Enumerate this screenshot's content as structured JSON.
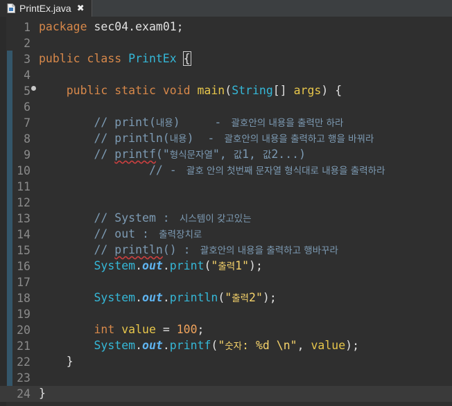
{
  "tab": {
    "title": "PrintEx.java",
    "close": "✖",
    "icon": "java-file-icon"
  },
  "colors": {
    "bg": "#2f2f2f",
    "keyword": "#d7884a",
    "type": "#35b8d8",
    "comment": "#7d9bb4",
    "string": "#f6d36b"
  },
  "lines": [
    {
      "n": "1",
      "tokens": [
        [
          "kw",
          "package"
        ],
        [
          "pl",
          " sec04.exam01;"
        ]
      ]
    },
    {
      "n": "2",
      "tokens": []
    },
    {
      "n": "3",
      "tokens": [
        [
          "kw",
          "public class "
        ],
        [
          "cls",
          "PrintEx"
        ],
        [
          "pl",
          " "
        ],
        [
          "brace",
          "{"
        ]
      ]
    },
    {
      "n": "4",
      "tokens": []
    },
    {
      "n": "5",
      "tokens": [
        [
          "pl",
          "    "
        ],
        [
          "kw",
          "public static void "
        ],
        [
          "fn",
          "main"
        ],
        [
          "pl",
          "("
        ],
        [
          "ty",
          "String"
        ],
        [
          "pl",
          "[] "
        ],
        [
          "fn",
          "args"
        ],
        [
          "pl",
          ") {"
        ]
      ]
    },
    {
      "n": "6",
      "tokens": []
    },
    {
      "n": "7",
      "tokens": [
        [
          "cm",
          "        // print("
        ],
        [
          "cmk",
          "내용"
        ],
        [
          "cm",
          ")     - "
        ],
        [
          "cmk",
          " 괄호안의 내용을 출력만 하라"
        ]
      ]
    },
    {
      "n": "8",
      "tokens": [
        [
          "cm",
          "        // println("
        ],
        [
          "cmk",
          "내용"
        ],
        [
          "cm",
          ")  - "
        ],
        [
          "cmk",
          " 괄호안의 내용을 출력하고 행을 바꿔라"
        ]
      ]
    },
    {
      "n": "9",
      "tokens": [
        [
          "cm",
          "        // "
        ],
        [
          "cmsq",
          "printf"
        ],
        [
          "cm",
          "(\""
        ],
        [
          "cmk",
          "형식문자열"
        ],
        [
          "cm",
          "\", "
        ],
        [
          "cmk",
          "값"
        ],
        [
          "cm",
          "1, "
        ],
        [
          "cmk",
          "값"
        ],
        [
          "cm",
          "2...)"
        ]
      ]
    },
    {
      "n": "10",
      "tokens": [
        [
          "cm",
          "                // - "
        ],
        [
          "cmk",
          " 괄호 안의 첫번째 문자열 형식대로 내용을 출력하라"
        ]
      ]
    },
    {
      "n": "11",
      "tokens": []
    },
    {
      "n": "12",
      "tokens": []
    },
    {
      "n": "13",
      "tokens": [
        [
          "cm",
          "        // System : "
        ],
        [
          "cmk",
          " 시스템이 갖고있는"
        ]
      ]
    },
    {
      "n": "14",
      "tokens": [
        [
          "cm",
          "        // out : "
        ],
        [
          "cmk",
          " 출력장치로"
        ]
      ]
    },
    {
      "n": "15",
      "tokens": [
        [
          "cm",
          "        // "
        ],
        [
          "cmsq",
          "println"
        ],
        [
          "cm",
          "() : "
        ],
        [
          "cmk",
          " 괄호안의 내용을 출력하고 행바꾸라"
        ]
      ]
    },
    {
      "n": "16",
      "tokens": [
        [
          "pl",
          "        "
        ],
        [
          "ty",
          "System"
        ],
        [
          "pl",
          "."
        ],
        [
          "it",
          "out"
        ],
        [
          "pl",
          "."
        ],
        [
          "ty",
          "print"
        ],
        [
          "pl",
          "("
        ],
        [
          "st",
          "\""
        ],
        [
          "stk",
          "출력"
        ],
        [
          "st",
          "1\""
        ],
        [
          "pl",
          ");"
        ]
      ]
    },
    {
      "n": "17",
      "tokens": []
    },
    {
      "n": "18",
      "tokens": [
        [
          "pl",
          "        "
        ],
        [
          "ty",
          "System"
        ],
        [
          "pl",
          "."
        ],
        [
          "it",
          "out"
        ],
        [
          "pl",
          "."
        ],
        [
          "ty",
          "println"
        ],
        [
          "pl",
          "("
        ],
        [
          "st",
          "\""
        ],
        [
          "stk",
          "출력"
        ],
        [
          "st",
          "2\""
        ],
        [
          "pl",
          ");"
        ]
      ]
    },
    {
      "n": "19",
      "tokens": []
    },
    {
      "n": "20",
      "tokens": [
        [
          "pl",
          "        "
        ],
        [
          "kw",
          "int "
        ],
        [
          "fn",
          "value"
        ],
        [
          "pl",
          " = "
        ],
        [
          "num",
          "100"
        ],
        [
          "pl",
          ";"
        ]
      ]
    },
    {
      "n": "21",
      "tokens": [
        [
          "pl",
          "        "
        ],
        [
          "ty",
          "System"
        ],
        [
          "pl",
          "."
        ],
        [
          "it",
          "out"
        ],
        [
          "pl",
          "."
        ],
        [
          "ty",
          "printf"
        ],
        [
          "pl",
          "("
        ],
        [
          "st",
          "\""
        ],
        [
          "stk",
          "숫자"
        ],
        [
          "st",
          ": %d \\n\""
        ],
        [
          "pl",
          ", "
        ],
        [
          "fn",
          "value"
        ],
        [
          "pl",
          ");"
        ]
      ]
    },
    {
      "n": "22",
      "tokens": [
        [
          "pl",
          "    }"
        ]
      ]
    },
    {
      "n": "23",
      "tokens": []
    },
    {
      "n": "24",
      "tokens": [
        [
          "pl",
          "}"
        ]
      ]
    }
  ]
}
